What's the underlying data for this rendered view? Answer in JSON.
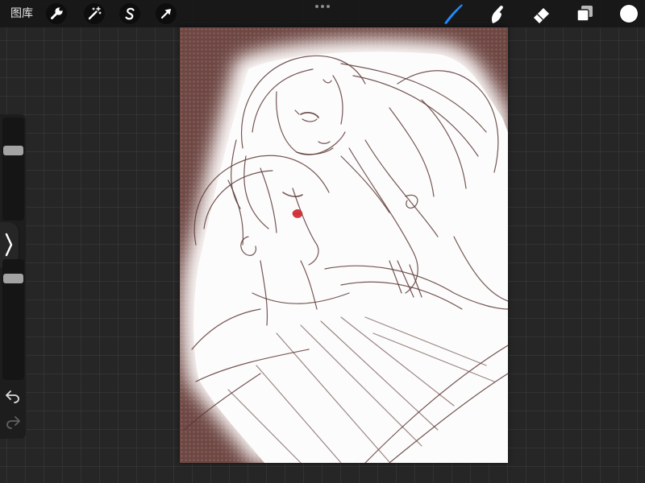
{
  "topbar": {
    "gallery_label": "图库",
    "action_icons": [
      "wrench-icon",
      "magic-wand-icon",
      "selection-icon",
      "transform-arrow-icon"
    ],
    "more_icon": "more-dots-icon"
  },
  "tools": {
    "icons": [
      "brush-icon",
      "smudge-icon",
      "eraser-icon",
      "layers-icon"
    ],
    "active_tool_icon": "brush-icon",
    "current_color": "#ffffff"
  },
  "sidebar": {
    "brush_size": 0.7,
    "opacity": 0.87,
    "toggle_icon": "chevron-right-icon",
    "undo_icon": "undo-icon",
    "redo_icon": "redo-icon",
    "redo_enabled": false
  },
  "colors": {
    "accent": "#1f8bff",
    "workspace": "#262626",
    "canvas_tone": "#6e4743",
    "sketch_stroke": "#5a3835",
    "lip_mark": "#d7373d"
  }
}
